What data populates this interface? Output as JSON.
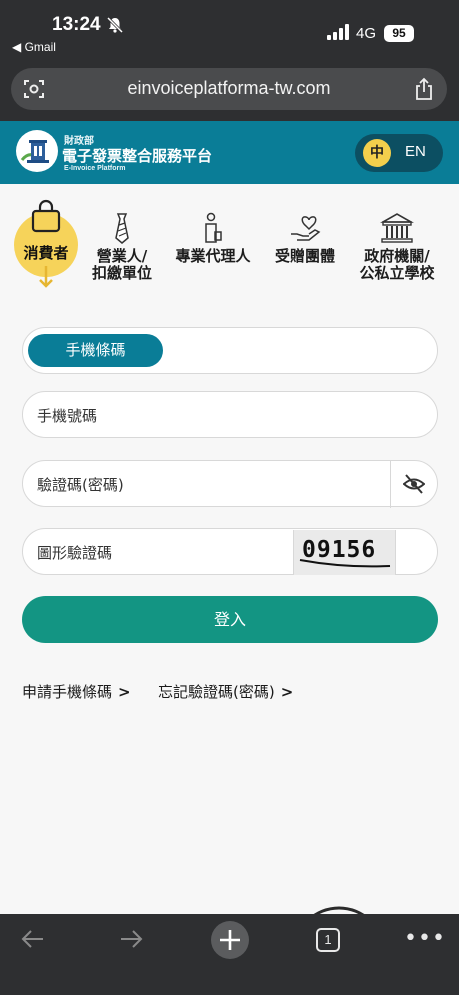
{
  "status_bar": {
    "time": "13:24",
    "back_app": "◀ Gmail",
    "network": "4G",
    "battery": "95"
  },
  "browser": {
    "url": "einvoiceplatforma-tw.com",
    "tab_count": "1"
  },
  "site_header": {
    "org_small": "財政部",
    "org_title": "電子發票整合服務平台",
    "org_en": "E-Invoice Platform",
    "lang_zh": "中",
    "lang_en": "EN"
  },
  "roles": [
    {
      "label": "消費者",
      "active": true
    },
    {
      "label_line1": "營業人/",
      "label_line2": "扣繳單位"
    },
    {
      "label": "專業代理人"
    },
    {
      "label": "受贈團體"
    },
    {
      "label_line1": "政府機關/",
      "label_line2": "公私立學校"
    }
  ],
  "form": {
    "tab_label": "手機條碼",
    "phone_placeholder": "手機號碼",
    "password_placeholder": "驗證碼(密碼)",
    "captcha_placeholder": "圖形驗證碼",
    "captcha_code": "09156",
    "login_label": "登入"
  },
  "links": {
    "apply": "申請手機條碼",
    "forgot": "忘記驗證碼(密碼)",
    "chevron": ">"
  },
  "colors": {
    "primary_teal": "#0a7d97",
    "login_green": "#139583",
    "accent_yellow": "#f6d35a",
    "chrome_dark": "#2e2f31"
  }
}
